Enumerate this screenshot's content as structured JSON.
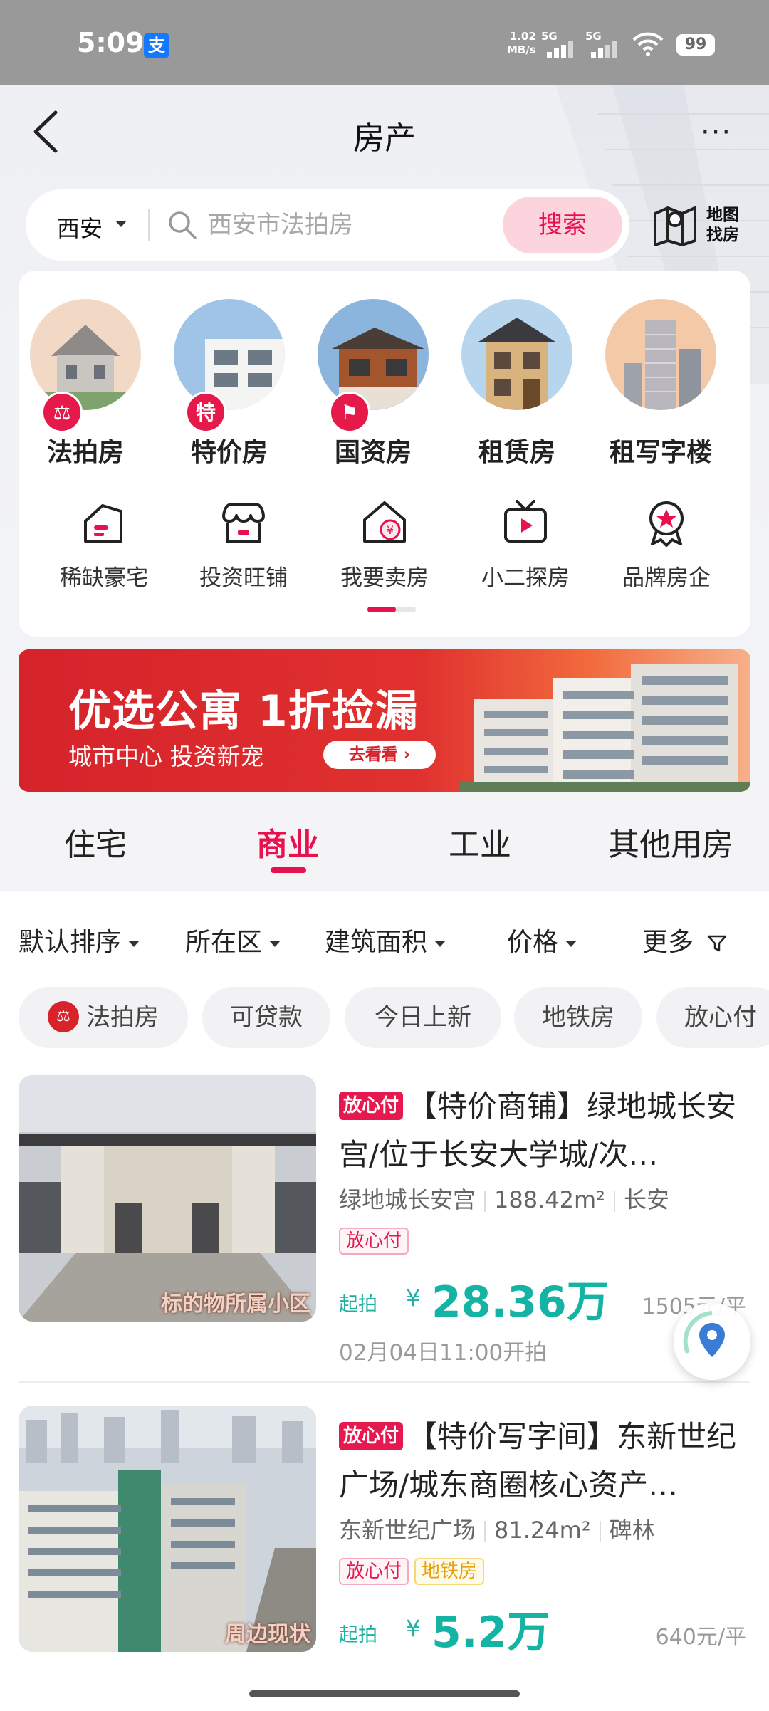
{
  "status": {
    "time": "5:09",
    "alipay": "支",
    "net_speed_value": "1.02",
    "net_speed_unit": "MB/s",
    "sim1": "5G",
    "sim2": "5G",
    "battery": "99"
  },
  "header": {
    "title": "房产",
    "more": "···"
  },
  "search": {
    "city": "西安",
    "placeholder": "西安市法拍房",
    "button_label": "搜索"
  },
  "map_find": {
    "line1": "地图",
    "line2": "找房"
  },
  "categories": [
    {
      "label": "法拍房",
      "badge": "⚖"
    },
    {
      "label": "特价房",
      "badge": "特"
    },
    {
      "label": "国资房",
      "badge": "⚑"
    },
    {
      "label": "租赁房",
      "badge": ""
    },
    {
      "label": "租写字楼",
      "badge": ""
    }
  ],
  "sub_categories": [
    {
      "label": "稀缺豪宅",
      "icon": "house-icon"
    },
    {
      "label": "投资旺铺",
      "icon": "shop-icon"
    },
    {
      "label": "我要卖房",
      "icon": "sell-house-icon"
    },
    {
      "label": "小二探房",
      "icon": "video-icon"
    },
    {
      "label": "品牌房企",
      "icon": "award-icon"
    }
  ],
  "banner": {
    "title": "优选公寓 1折捡漏",
    "subtitle": "城市中心 投资新宠",
    "button_label": "去看看 ›"
  },
  "type_tabs": [
    "住宅",
    "商业",
    "工业",
    "其他用房"
  ],
  "active_type_tab": "商业",
  "filters": [
    "默认排序",
    "所在区",
    "建筑面积",
    "价格",
    "更多"
  ],
  "quick_tags": [
    "法拍房",
    "可贷款",
    "今日上新",
    "地铁房",
    "放心付"
  ],
  "listings": [
    {
      "badge": "放心付",
      "title": "【特价商铺】绿地城长安宫/位于长安大学城/次…",
      "community": "绿地城长安宫",
      "area": "188.42m²",
      "district": "长安",
      "tags": [
        "放心付"
      ],
      "price_prefix": "起拍",
      "currency": "¥",
      "price": "28.36万",
      "unit_price": "1505",
      "unit_price_suffix": "元/平",
      "auction_time": "02月04日11:00开拍",
      "image_caption": "标的物所属小区"
    },
    {
      "badge": "放心付",
      "title": "【特价写字间】东新世纪广场/城东商圈核心资产…",
      "community": "东新世纪广场",
      "area": "81.24m²",
      "district": "碑林",
      "tags": [
        "放心付",
        "地铁房"
      ],
      "price_prefix": "起拍",
      "currency": "¥",
      "price": "5.2万",
      "unit_price": "640元/平",
      "auction_time": "",
      "image_caption": "周边现状"
    }
  ],
  "colors": {
    "accent": "#e8114f",
    "price": "#15b3a3",
    "banner": "#d5232b"
  }
}
